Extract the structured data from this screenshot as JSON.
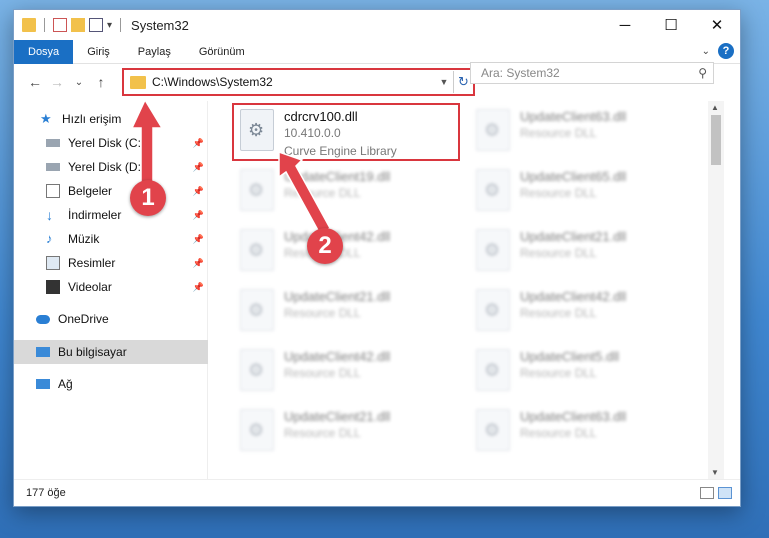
{
  "window": {
    "title": "System32",
    "controls": {
      "minimize": "─",
      "maximize": "☐",
      "close": "✕"
    }
  },
  "ribbon": {
    "tabs": [
      "Dosya",
      "Giriş",
      "Paylaş",
      "Görünüm"
    ],
    "help": "?"
  },
  "navbar": {
    "back": "←",
    "forward": "→",
    "recent": "⌄",
    "up": "↑",
    "address": "C:\\Windows\\System32",
    "refresh": "↻",
    "search_placeholder": "Ara: System32"
  },
  "sidebar": {
    "items": [
      {
        "label": "Hızlı erişim"
      },
      {
        "label": "Yerel Disk (C:)"
      },
      {
        "label": "Yerel Disk (D:)"
      },
      {
        "label": "Belgeler"
      },
      {
        "label": "İndirmeler"
      },
      {
        "label": "Müzik"
      },
      {
        "label": "Resimler"
      },
      {
        "label": "Videolar"
      },
      {
        "label": "OneDrive"
      },
      {
        "label": "Bu bilgisayar"
      },
      {
        "label": "Ağ"
      }
    ]
  },
  "files": {
    "highlighted": {
      "name": "cdrcrv100.dll",
      "version": "10.410.0.0",
      "description": "Curve Engine Library"
    },
    "left_column": [
      {
        "name": "UpdateClient19.dll",
        "desc": "Resource DLL"
      },
      {
        "name": "UpdateClient42.dll",
        "desc": "Resource DLL"
      },
      {
        "name": "UpdateClient21.dll",
        "desc": "Resource DLL"
      },
      {
        "name": "UpdateClient42.dll",
        "desc": "Resource DLL"
      },
      {
        "name": "UpdateClient21.dll",
        "desc": "Resource DLL"
      }
    ],
    "right_column": [
      {
        "name": "UpdateClient63.dll",
        "desc": "Resource DLL"
      },
      {
        "name": "UpdateClient65.dll",
        "desc": "Resource DLL"
      },
      {
        "name": "UpdateClient21.dll",
        "desc": "Resource DLL"
      },
      {
        "name": "UpdateClient42.dll",
        "desc": "Resource DLL"
      },
      {
        "name": "UpdateClient5.dll",
        "desc": "Resource DLL"
      },
      {
        "name": "UpdateClient63.dll",
        "desc": "Resource DLL"
      }
    ]
  },
  "status": {
    "count": "177 öğe"
  },
  "annotations": {
    "step1": "1",
    "step2": "2"
  },
  "colors": {
    "accent": "#1a6fc4",
    "highlight": "#d9363e",
    "badge": "#e1434b"
  }
}
